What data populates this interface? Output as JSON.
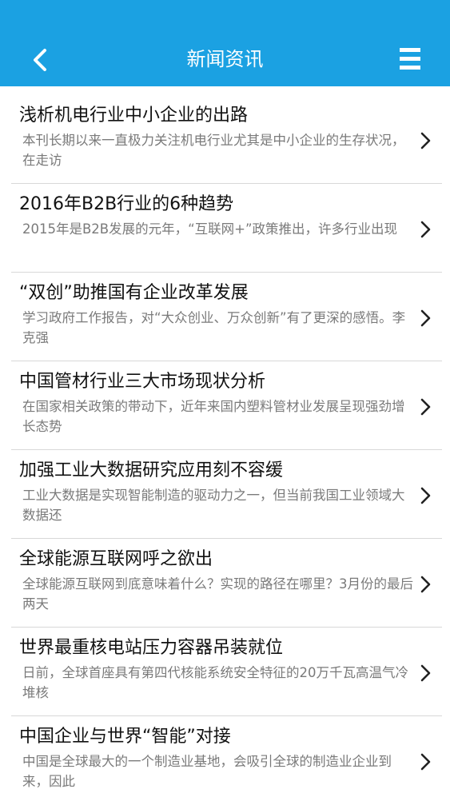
{
  "header": {
    "title": "新闻资讯",
    "back_icon": "chevron-left-icon",
    "menu_icon": "hamburger-menu-icon",
    "bar_color": "#1ba1e2"
  },
  "news": [
    {
      "title": "浅析机电行业中小企业的出路",
      "summary": "本刊长期以来一直极力关注机电行业尤其是中小企业的生存状况，在走访"
    },
    {
      "title": "2016年B2B行业的6种趋势",
      "summary": "2015年是B2B发展的元年，“互联网+”政策推出，许多行业出现"
    },
    {
      "title": "“双创”助推国有企业改革发展",
      "summary": "学习政府工作报告，对“大众创业、万众创新”有了更深的感悟。李克强"
    },
    {
      "title": "中国管材行业三大市场现状分析",
      "summary": "在国家相关政策的带动下，近年来国内塑料管材业发展呈现强劲增长态势"
    },
    {
      "title": "加强工业大数据研究应用刻不容缓",
      "summary": "工业大数据是实现智能制造的驱动力之一，但当前我国工业领域大数据还"
    },
    {
      "title": "全球能源互联网呼之欲出",
      "summary": "全球能源互联网到底意味着什么？实现的路径在哪里？3月份的最后两天"
    },
    {
      "title": "世界最重核电站压力容器吊装就位",
      "summary": "日前，全球首座具有第四代核能系统安全特征的20万千瓦高温气冷堆核"
    },
    {
      "title": "中国企业与世界“智能”对接",
      "summary": "中国是全球最大的一个制造业基地，会吸引全球的制造业企业到来，因此"
    }
  ]
}
